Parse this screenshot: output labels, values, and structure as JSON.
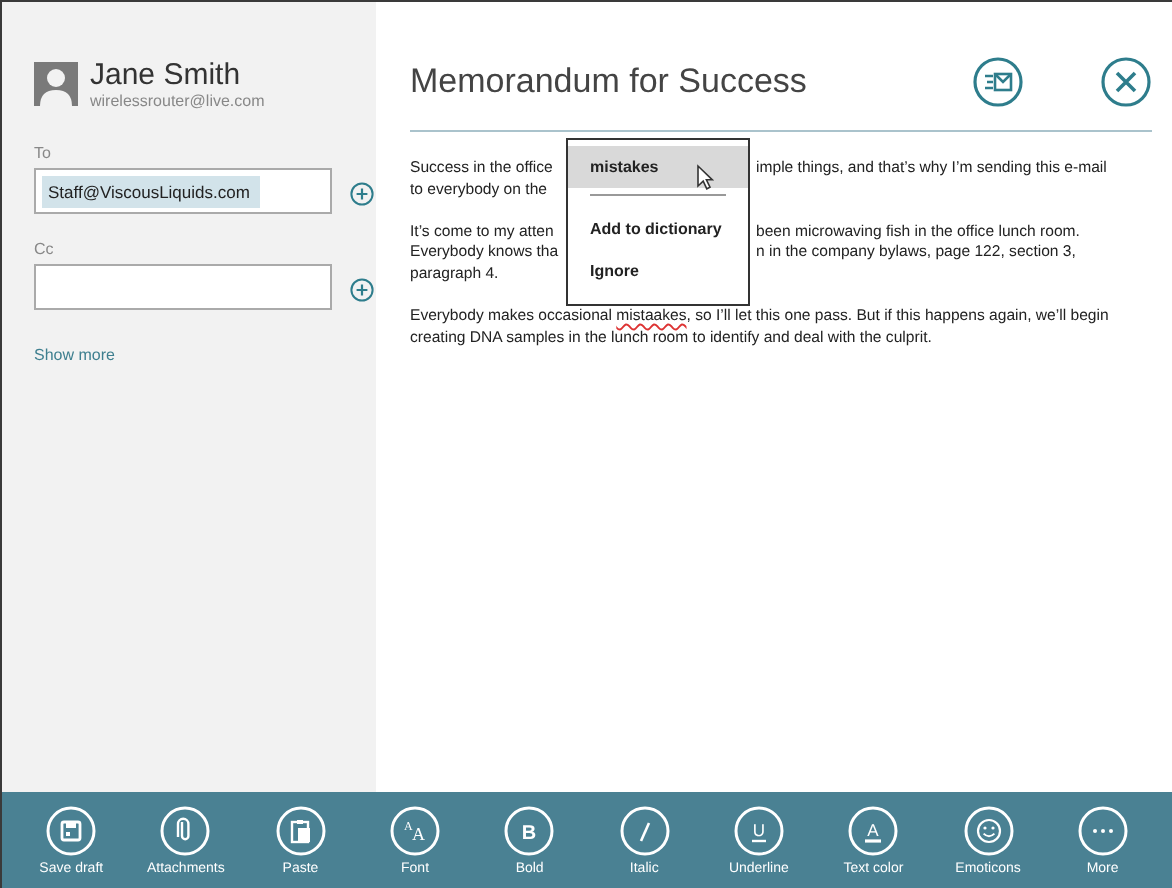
{
  "sender": {
    "name": "Jane Smith",
    "email": "wirelessrouter@live.com"
  },
  "fields": [
    {
      "label": "To",
      "recipient": "Staff@ViscousLiquids.com"
    },
    {
      "label": "Cc"
    }
  ],
  "show_more": "Show more",
  "subject": "Memorandum for Success",
  "body": [
    {
      "kind": "cut",
      "lines": [
        [
          "Success in the office",
          "imple things, and that’s why I’m sending this e-mail"
        ],
        [
          "to everybody on the"
        ]
      ]
    },
    {
      "kind": "cut",
      "lines": [
        [
          "It’s come to my atten",
          "been microwaving fish in the office lunch room."
        ],
        [
          "Everybody knows tha",
          "n in the company bylaws, page 122, section 3,"
        ],
        [
          "paragraph 4."
        ]
      ]
    },
    {
      "kind": "text",
      "segments": [
        {
          "text": "Everybody makes occasional ",
          "misspelled": false
        },
        {
          "text": "mistaakes",
          "misspelled": true
        },
        {
          "text": ", so I’ll let this one pass. But if this happens again, we’ll begin creating DNA samples in the lunch room to identify and deal with the culprit.",
          "misspelled": false
        }
      ]
    }
  ],
  "context_menu": [
    {
      "kind": "item",
      "label": "mistakes",
      "selected": true
    },
    {
      "kind": "separator"
    },
    {
      "kind": "item",
      "label": "Add to dictionary",
      "selected": false
    },
    {
      "kind": "item",
      "label": "Ignore",
      "selected": false
    }
  ],
  "app_bar": [
    {
      "label": "Save draft"
    },
    {
      "label": "Attachments"
    },
    {
      "label": "Paste"
    },
    {
      "label": "Font",
      "glyphs": [
        "A",
        "A"
      ]
    },
    {
      "label": "Bold",
      "glyphs": [
        "B"
      ]
    },
    {
      "label": "Italic"
    },
    {
      "label": "Underline",
      "glyphs": [
        "U"
      ]
    },
    {
      "label": "Text color",
      "glyphs": [
        "A"
      ]
    },
    {
      "label": "Emoticons"
    },
    {
      "label": "More"
    }
  ]
}
